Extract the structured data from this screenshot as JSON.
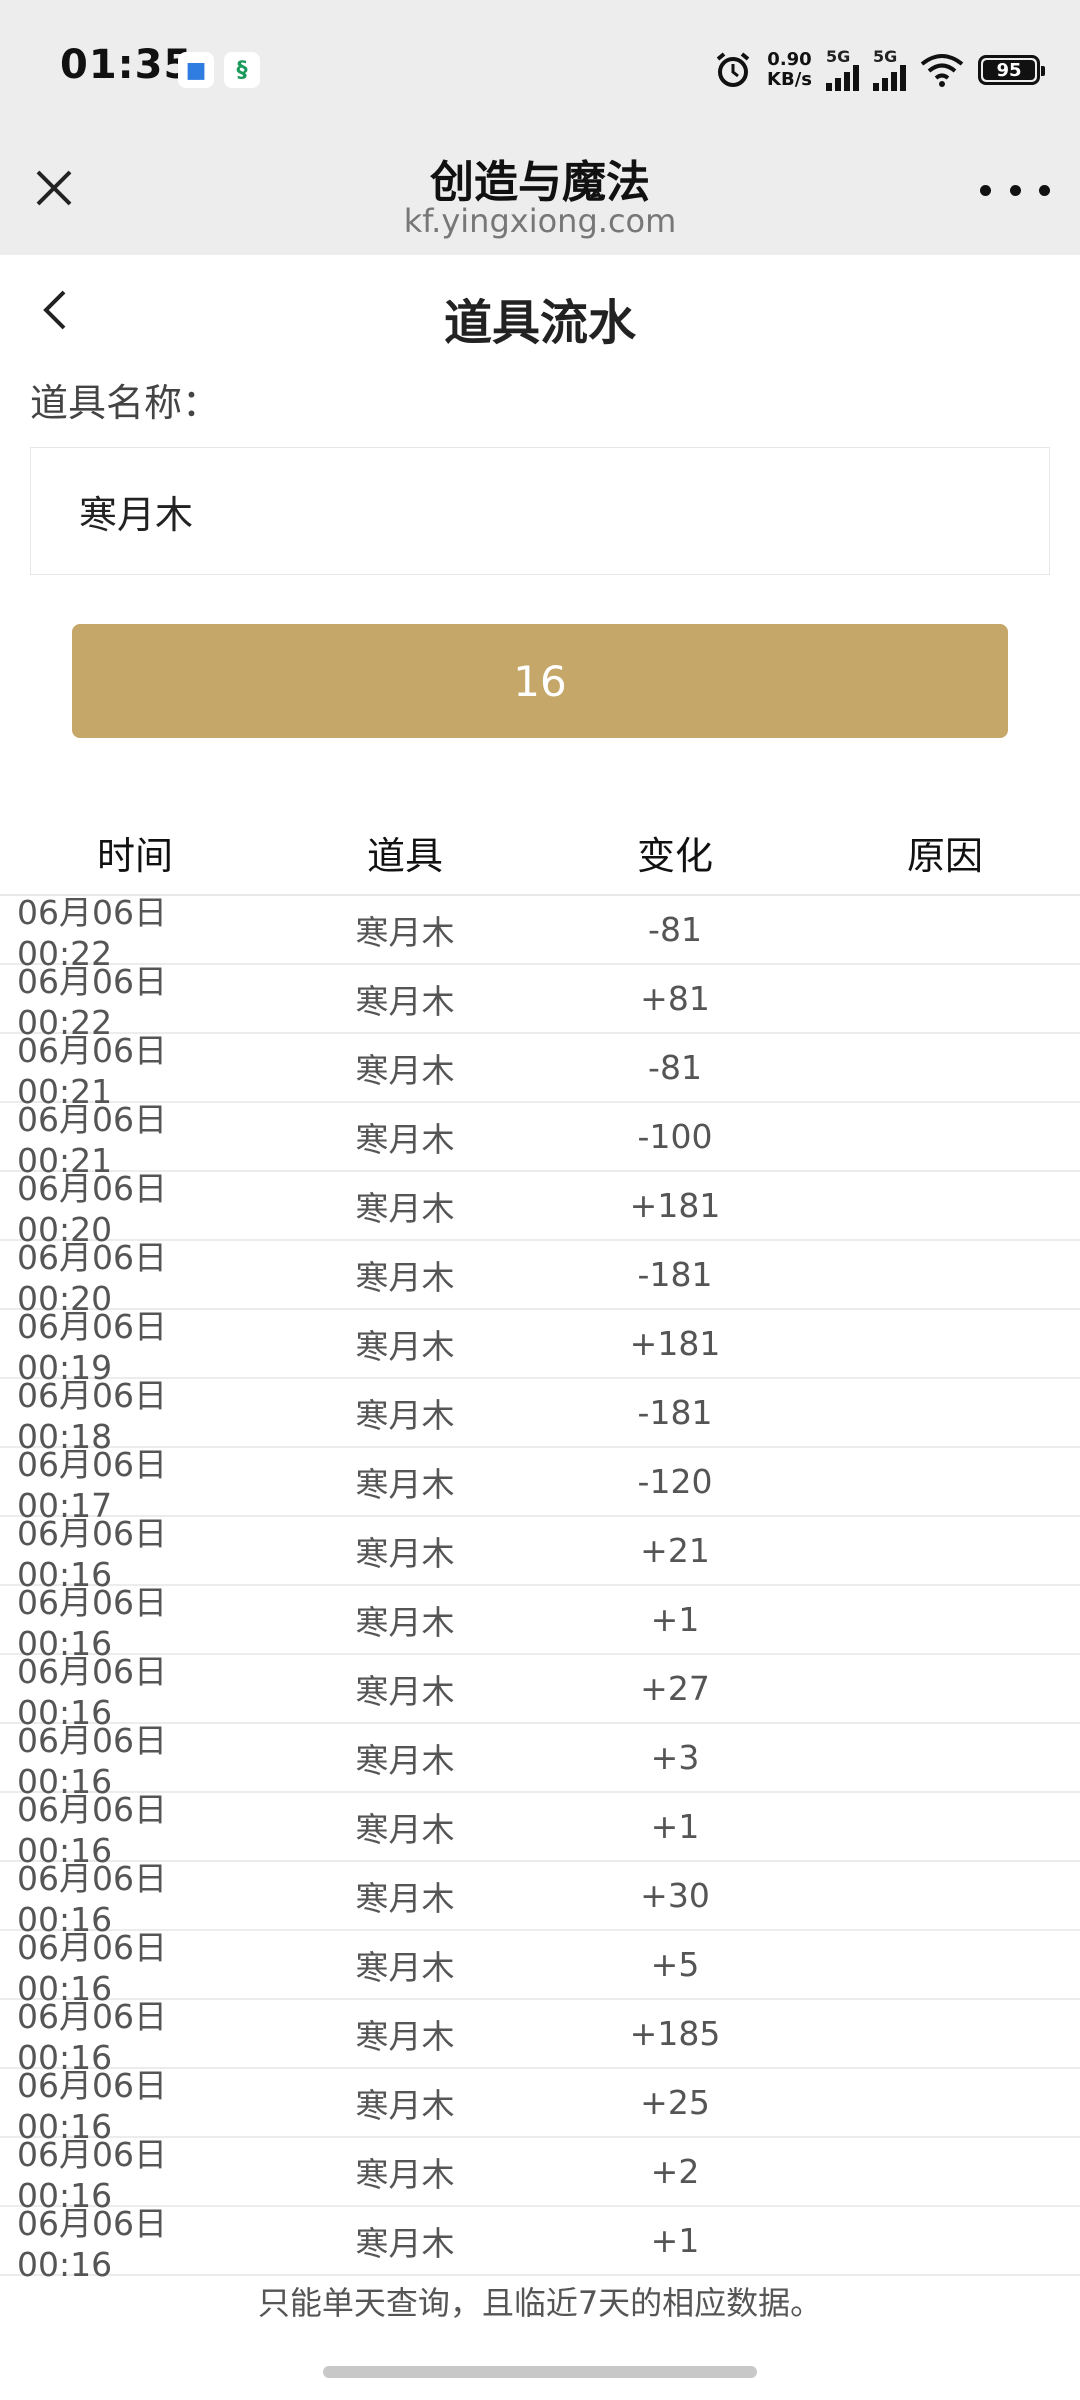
{
  "status_bar": {
    "time": "01:35",
    "net_speed_value": "0.90",
    "net_speed_unit": "KB/s",
    "sim1_label": "5G",
    "sim2_label": "5G",
    "battery": "95",
    "icons": [
      "app-notification-icon",
      "app-notification-icon-2",
      "alarm-icon",
      "wifi-icon",
      "battery-icon"
    ]
  },
  "browser": {
    "title": "创造与魔法",
    "url": "kf.yingxiong.com"
  },
  "page": {
    "title": "道具流水",
    "field_label": "道具名称：",
    "item_value": "寒月木",
    "submit_label": "16"
  },
  "table": {
    "headers": [
      "时间",
      "道具",
      "变化",
      "原因"
    ],
    "rows": [
      {
        "time": "06月06日 00:22",
        "item": "寒月木",
        "change": "-81",
        "reason": ""
      },
      {
        "time": "06月06日 00:22",
        "item": "寒月木",
        "change": "+81",
        "reason": ""
      },
      {
        "time": "06月06日 00:21",
        "item": "寒月木",
        "change": "-81",
        "reason": ""
      },
      {
        "time": "06月06日 00:21",
        "item": "寒月木",
        "change": "-100",
        "reason": ""
      },
      {
        "time": "06月06日 00:20",
        "item": "寒月木",
        "change": "+181",
        "reason": ""
      },
      {
        "time": "06月06日 00:20",
        "item": "寒月木",
        "change": "-181",
        "reason": ""
      },
      {
        "time": "06月06日 00:19",
        "item": "寒月木",
        "change": "+181",
        "reason": ""
      },
      {
        "time": "06月06日 00:18",
        "item": "寒月木",
        "change": "-181",
        "reason": ""
      },
      {
        "time": "06月06日 00:17",
        "item": "寒月木",
        "change": "-120",
        "reason": ""
      },
      {
        "time": "06月06日 00:16",
        "item": "寒月木",
        "change": "+21",
        "reason": ""
      },
      {
        "time": "06月06日 00:16",
        "item": "寒月木",
        "change": "+1",
        "reason": ""
      },
      {
        "time": "06月06日 00:16",
        "item": "寒月木",
        "change": "+27",
        "reason": ""
      },
      {
        "time": "06月06日 00:16",
        "item": "寒月木",
        "change": "+3",
        "reason": ""
      },
      {
        "time": "06月06日 00:16",
        "item": "寒月木",
        "change": "+1",
        "reason": ""
      },
      {
        "time": "06月06日 00:16",
        "item": "寒月木",
        "change": "+30",
        "reason": ""
      },
      {
        "time": "06月06日 00:16",
        "item": "寒月木",
        "change": "+5",
        "reason": ""
      },
      {
        "time": "06月06日 00:16",
        "item": "寒月木",
        "change": "+185",
        "reason": ""
      },
      {
        "time": "06月06日 00:16",
        "item": "寒月木",
        "change": "+25",
        "reason": ""
      },
      {
        "time": "06月06日 00:16",
        "item": "寒月木",
        "change": "+2",
        "reason": ""
      },
      {
        "time": "06月06日 00:16",
        "item": "寒月木",
        "change": "+1",
        "reason": ""
      }
    ]
  },
  "footer_note": "只能单天查询，且临近7天的相应数据。",
  "colors": {
    "accent": "#c4a769",
    "header_bg": "#ededed"
  }
}
